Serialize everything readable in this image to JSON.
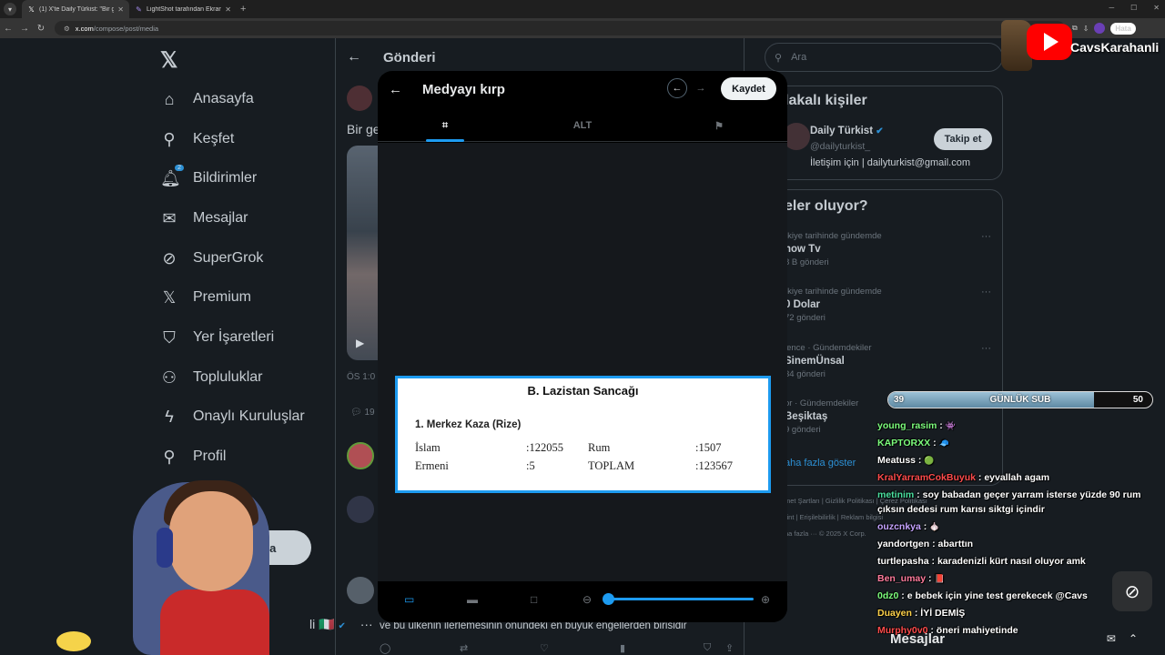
{
  "browser": {
    "tabs": [
      {
        "title": "(1) X'te Daily Türkist: \"Bir genç...",
        "favicon": "x-icon",
        "active": true
      },
      {
        "title": "LightShot tarafından Ekran Görü...",
        "favicon": "feather-icon",
        "active": false
      }
    ],
    "url_host": "x.com",
    "url_path": "/compose/post/media",
    "error_chip": "Hata"
  },
  "sidebar": {
    "items": [
      {
        "label": "Anasayfa",
        "icon": "home-icon"
      },
      {
        "label": "Keşfet",
        "icon": "search-icon"
      },
      {
        "label": "Bildirimler",
        "icon": "bell-icon",
        "badge": "2"
      },
      {
        "label": "Mesajlar",
        "icon": "mail-icon"
      },
      {
        "label": "SuperGrok",
        "icon": "grok-icon"
      },
      {
        "label": "Premium",
        "icon": "x-premium-icon"
      },
      {
        "label": "Yer İşaretleri",
        "icon": "bookmark-icon"
      },
      {
        "label": "Topluluklar",
        "icon": "communities-icon"
      },
      {
        "label": "Onaylı Kuruluşlar",
        "icon": "lightning-icon"
      },
      {
        "label": "Profil",
        "icon": "person-icon"
      },
      {
        "label": "a",
        "icon": "more-circle-icon"
      }
    ],
    "post_button": "unla",
    "profile_name_fragment": "li"
  },
  "main": {
    "title": "Gönderi",
    "tweet_text_fragment": "Bir ge",
    "time_fragment": "ÖS 1:0",
    "reply_count_fragment": "19",
    "reply_text": "ve bu ülkenin ilerlemesinin önündeki en büyük engellerden birisidir",
    "actions": {
      "replies": "3",
      "reposts": "8",
      "likes": "444",
      "views": "8 B"
    }
  },
  "right": {
    "search_placeholder": "Ara",
    "who_title": "lakalı kişiler",
    "follow": {
      "name": "Daily Türkist",
      "handle": "@dailyturkist_",
      "bio": "İletişim için | dailyturkist@gmail.com",
      "button": "Takip et"
    },
    "trends_title": "eler oluyor?",
    "trends": [
      {
        "meta": "rkiye tarihinde gündemde",
        "name": "how Tv",
        "count": "8 B gönderi"
      },
      {
        "meta": "rkiye tarihinde gündemde",
        "name": "0 Dolar",
        "count": "72 gönderi"
      },
      {
        "meta": "lence · Gündemdekiler",
        "name": "SinemÜnsal",
        "count": "34 gönderi"
      },
      {
        "meta": "or · Gündemdekiler",
        "name": "Beşiktaş",
        "count": "9 gönderi"
      }
    ],
    "show_more": "aha fazla göster",
    "footer": [
      "met Şartları  |  Gizlilik Politikası  |  Çerez Politikası",
      "rint  |  Erişilebilirlik  |  Reklam bilgisi",
      "ha fazla ···  © 2025 X Corp."
    ]
  },
  "modal": {
    "title": "Medyayı kırp",
    "save": "Kaydet",
    "tabs": {
      "crop": "crop-icon",
      "alt": "ALT",
      "flag": "flag-icon"
    },
    "document": {
      "title": "B. Lazistan Sancağı",
      "subtitle": "1. Merkez Kaza (Rize)",
      "rows": [
        [
          "İslam",
          ":122055",
          "Rum",
          ":1507"
        ],
        [
          "Ermeni",
          ":5",
          "TOPLAM",
          ":123567"
        ]
      ]
    },
    "zoom_level": 0
  },
  "stream": {
    "channel": "CavsKarahanli",
    "subgoal": {
      "current": "39",
      "label": "GÜNLÜK SUB",
      "target": "50",
      "progress": 0.78
    },
    "chat": [
      {
        "user": "young_rasim",
        "color": "#7CFC7C",
        "text": "",
        "emote": "👾"
      },
      {
        "user": "KAPTORXX",
        "color": "#7CFC7C",
        "text": "",
        "emote": "🧢"
      },
      {
        "user": "Meatuss",
        "color": "#ffffff",
        "text": "",
        "emote": "🟢"
      },
      {
        "user": "KralYarramCokBuyuk",
        "color": "#ff4b4b",
        "text": "eyvallah agam",
        "emote": ""
      },
      {
        "user": "metinim",
        "color": "#4be0a0",
        "text": "soy babadan geçer yarram isterse yüzde 90 rum",
        "emote": ""
      },
      {
        "user": "",
        "color": "#ffffff",
        "text": "çıksın dedesi rum karısı siktgi içindir",
        "emote": ""
      },
      {
        "user": "ouzcnkya",
        "color": "#c5a3ff",
        "text": "",
        "emote": "🧄"
      },
      {
        "user": "yandortgen",
        "color": "#ffffff",
        "text": "abarttın",
        "emote": ""
      },
      {
        "user": "turtlepasha",
        "color": "#ffffff",
        "text": "karadenizli kürt nasıl oluyor amk",
        "emote": ""
      },
      {
        "user": "Ben_umay",
        "color": "#ff7b9c",
        "text": "",
        "emote": "📕"
      },
      {
        "user": "0dz0",
        "color": "#7CFC7C",
        "text": "e bebek için yine test gerekecek @Cavs",
        "emote": ""
      },
      {
        "user": "Duayen",
        "color": "#ffd24a",
        "text": "İYİ DEMİŞ",
        "emote": ""
      },
      {
        "user": "Murphy0v0",
        "color": "#ff4b4b",
        "text": "öneri mahiyetinde",
        "emote": ""
      }
    ],
    "messages_dock": "Mesajlar"
  }
}
